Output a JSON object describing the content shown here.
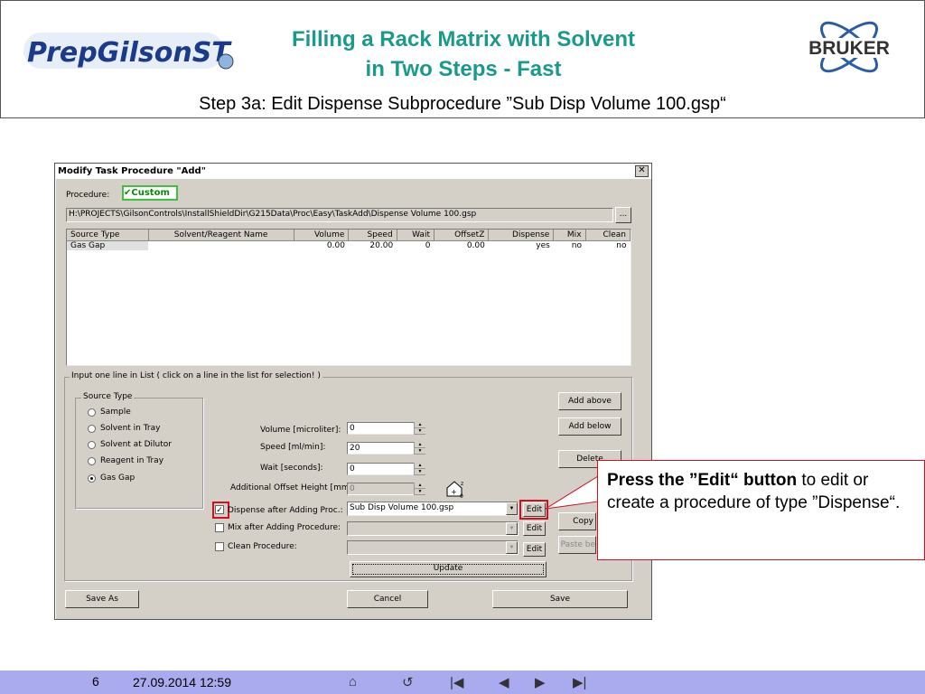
{
  "header": {
    "title_line1": "Filling a Rack Matrix with Solvent",
    "title_line2": "in Two Steps - Fast",
    "subtitle": "Step 3a: Edit Dispense Subprocedure ”Sub Disp Volume 100.gsp“",
    "logo_left_text": "PrepGilsonST",
    "logo_right_text": "BRUKER"
  },
  "dialog": {
    "title": "Modify Task Procedure \"Add\"",
    "close_glyph": "✕",
    "procedure_label": "Procedure:",
    "procedure_badge": "Custom",
    "path": "H:\\PROJECTS\\GilsonControls\\InstallShieldDir\\G215Data\\Proc\\Easy\\TaskAdd\\Dispense Volume 100.gsp",
    "browse_label": "...",
    "list": {
      "columns": [
        "Source Type",
        "Solvent/Reagent Name",
        "Volume",
        "Speed",
        "Wait",
        "OffsetZ",
        "Dispense",
        "Mix",
        "Clean"
      ],
      "rows": [
        [
          "Gas Gap",
          "",
          "0.00",
          "20.00",
          "0",
          "0.00",
          "yes",
          "no",
          "no"
        ]
      ]
    },
    "input_group_label": "Input one line in List ( click on a line in the list for selection! )",
    "source_type": {
      "label": "Source Type",
      "options": [
        "Sample",
        "Solvent in Tray",
        "Solvent at Dilutor",
        "Reagent in Tray",
        "Gas Gap"
      ],
      "selected": "Gas Gap"
    },
    "volume": {
      "label": "Volume [microliter]:",
      "value": "0"
    },
    "speed": {
      "label": "Speed [ml/min]:",
      "value": "20"
    },
    "wait": {
      "label": "Wait [seconds]:",
      "value": "0"
    },
    "offset": {
      "label": "Additional Offset Height [mm]:",
      "value": "0"
    },
    "dispense": {
      "label": "Dispense after Adding  Proc.:",
      "checked": true,
      "value": "Sub Disp Volume 100.gsp",
      "edit_label": "Edit"
    },
    "mix": {
      "label": "Mix after Adding   Procedure:",
      "checked": false,
      "value": "",
      "edit_label": "Edit"
    },
    "clean": {
      "label": "Clean  Procedure:",
      "checked": false,
      "value": "",
      "edit_label": "Edit"
    },
    "buttons": {
      "add_above": "Add above",
      "add_below": "Add below",
      "delete": "Delete",
      "copy": "Copy",
      "paste": "Paste be",
      "update": "Update",
      "save_as": "Save As",
      "cancel": "Cancel",
      "save": "Save"
    }
  },
  "callout": {
    "bold_text": "Press the ”Edit“ button",
    "normal_text": " to edit or create a procedure of type ”Dispense“."
  },
  "footer": {
    "page": "6",
    "datetime": "27.09.2014 12:59",
    "nav_icons": [
      "home-icon",
      "return-icon",
      "first-icon",
      "prev-icon",
      "next-icon",
      "last-icon"
    ]
  },
  "colors": {
    "title": "#1a9a8a",
    "footer_bg": "#aaaaee",
    "highlight_red": "#d01020",
    "dialog_bg": "#d4d0c8"
  }
}
